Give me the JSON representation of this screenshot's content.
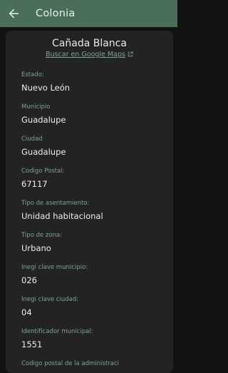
{
  "appbar": {
    "title": "Colonia",
    "back_icon": "arrow-back-icon"
  },
  "colors": {
    "appbar": "#4a6e58",
    "accent": "#7fa48c",
    "background": "#121212",
    "card": "#232323"
  },
  "header": {
    "title": "Cañada Blanca",
    "maps_link": "Buscar en Google Maps",
    "maps_icon": "external-link-icon"
  },
  "fields": [
    {
      "label": "Estado:",
      "value": "Nuevo León"
    },
    {
      "label": "Municipio",
      "value": "Guadalupe"
    },
    {
      "label": "Ciudad",
      "value": "Guadalupe"
    },
    {
      "label": "Codigo Postal:",
      "value": "67117"
    },
    {
      "label": "Tipo de asentamiento:",
      "value": "Unidad habitacional"
    },
    {
      "label": "Tipo de zona:",
      "value": "Urbano"
    },
    {
      "label": "Inegi clave municipio:",
      "value": "026"
    },
    {
      "label": "Inegi clave ciudad:",
      "value": "04"
    },
    {
      "label": "Identificador municipal:",
      "value": "1551"
    },
    {
      "label": "Codigo postal de la administraci",
      "value": ""
    }
  ]
}
